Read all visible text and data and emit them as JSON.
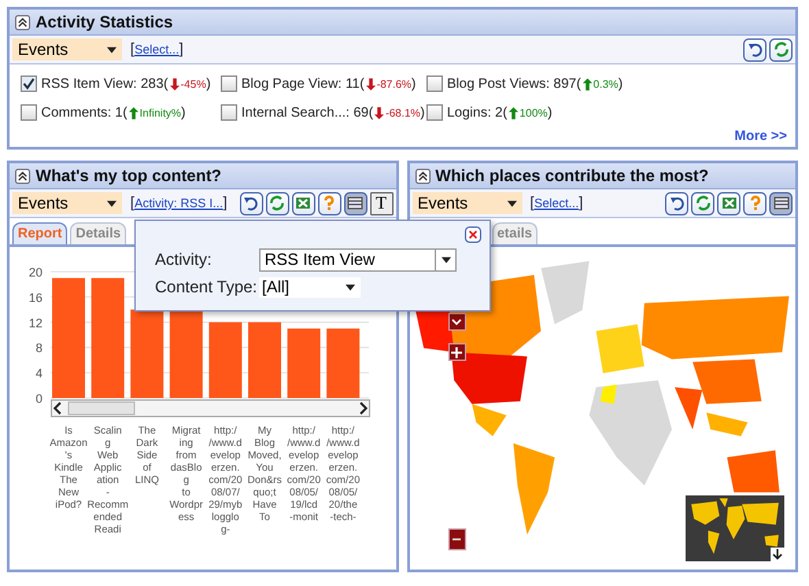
{
  "activity_statistics": {
    "title": "Activity Statistics",
    "dropdown": {
      "value": "Events"
    },
    "link": {
      "before": "[",
      "text": "Select...",
      "after": "]"
    },
    "toolbar": [
      {
        "kind": "undo",
        "pressed": false
      },
      {
        "kind": "refresh",
        "pressed": false
      }
    ],
    "items": [
      {
        "label": "RSS Item View: 283(",
        "change": "-45%",
        "close": ")",
        "kind": "down",
        "checked": true
      },
      {
        "label": "Blog Page View: 11(",
        "change": "-87.6%",
        "close": ")",
        "kind": "down",
        "checked": false
      },
      {
        "label": "Blog Post Views: 897(",
        "change": "0.3%",
        "close": ")",
        "kind": "up",
        "checked": false
      },
      {
        "label": "Comments: 1(",
        "change": "Infinity%",
        "close": ")",
        "kind": "up",
        "checked": false
      },
      {
        "label": "Internal Search...: 69(",
        "change": "-68.1%",
        "close": ")",
        "kind": "down",
        "checked": false
      },
      {
        "label": "Logins: 2(",
        "change": "100%",
        "close": ")",
        "kind": "up",
        "checked": false
      }
    ],
    "more_link": "More >>"
  },
  "top_content": {
    "title": "What's my top content?",
    "dropdown": {
      "value": "Events"
    },
    "link": {
      "before": "[",
      "text": "Activity: RSS I...",
      "after": "]"
    },
    "toolbar": [
      {
        "kind": "undo",
        "pressed": false
      },
      {
        "kind": "refresh",
        "pressed": false
      },
      {
        "kind": "excel",
        "pressed": false
      },
      {
        "kind": "help",
        "pressed": false
      },
      {
        "kind": "table",
        "pressed": true
      },
      {
        "kind": "text",
        "label": "T",
        "pressed": false
      }
    ],
    "tabs": [
      {
        "label": "Report",
        "selected": true
      },
      {
        "label": "Details",
        "selected": false
      }
    ],
    "chart_data": {
      "type": "bar",
      "categories": [
        "Is Amazon's Kindle The New iPod?",
        "Scaling Web Application - Recommended Readi",
        "The Dark Side of LINQ",
        "Migrating from dasBlog to Wordpress",
        "http://www.developerzen.com/2008/07/29/myblogglog-",
        "My Blog Moved, You Don&rsquo;t Have To",
        "http://www.developerzen.com/2008/05/19/lcd-monit",
        "http://www.developerzen.com/2008/05/20/the-tech-"
      ],
      "values": [
        19,
        19,
        14,
        14,
        12,
        12,
        11,
        11
      ],
      "ylim": [
        0,
        20
      ],
      "yticks": [
        0,
        4,
        8,
        12,
        16,
        20
      ],
      "grid": true
    }
  },
  "places": {
    "title": "Which places contribute the most?",
    "dropdown": {
      "value": "Events"
    },
    "link": {
      "before": "[",
      "text": "Select...",
      "after": "]"
    },
    "toolbar": [
      {
        "kind": "undo",
        "pressed": false
      },
      {
        "kind": "refresh",
        "pressed": false
      },
      {
        "kind": "excel",
        "pressed": false
      },
      {
        "kind": "help",
        "pressed": false
      },
      {
        "kind": "table",
        "pressed": true
      }
    ],
    "tabs": [
      {
        "label": "etails",
        "selected": false
      }
    ]
  },
  "filter_popup": {
    "fields": [
      {
        "label": "Activity:",
        "value": "RSS Item View",
        "kind": "combo"
      },
      {
        "label": "Content Type:",
        "value": "[All]",
        "kind": "select"
      }
    ]
  }
}
